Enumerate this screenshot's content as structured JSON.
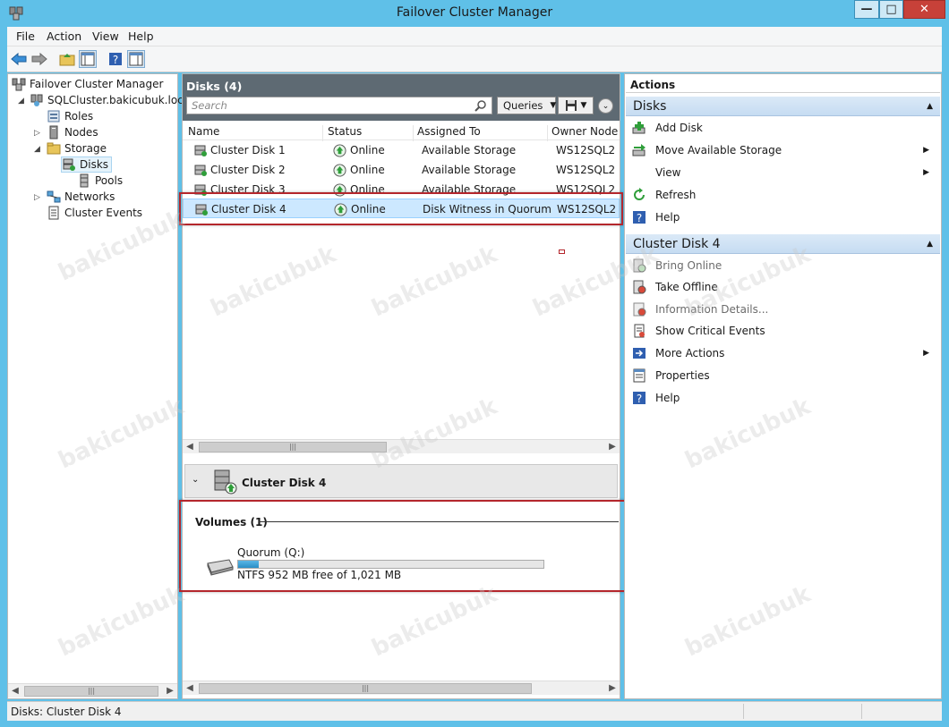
{
  "window": {
    "title": "Failover Cluster Manager",
    "btn_minimize": "—",
    "btn_maximize": "□",
    "btn_close": "✕"
  },
  "menu": [
    "File",
    "Action",
    "View",
    "Help"
  ],
  "tree": {
    "root": "Failover Cluster Manager",
    "cluster": "SQLCluster.bakicubuk.local",
    "roles": "Roles",
    "nodes": "Nodes",
    "storage": "Storage",
    "disks": "Disks",
    "pools": "Pools",
    "networks": "Networks",
    "events": "Cluster Events"
  },
  "center": {
    "title": "Disks (4)",
    "search_placeholder": "Search",
    "queries_label": "Queries",
    "columns": [
      "Name",
      "Status",
      "Assigned To",
      "Owner Node"
    ],
    "rows": [
      {
        "name": "Cluster Disk 1",
        "status": "Online",
        "assigned": "Available Storage",
        "owner": "WS12SQL2"
      },
      {
        "name": "Cluster Disk 2",
        "status": "Online",
        "assigned": "Available Storage",
        "owner": "WS12SQL2"
      },
      {
        "name": "Cluster Disk 3",
        "status": "Online",
        "assigned": "Available Storage",
        "owner": "WS12SQL2"
      },
      {
        "name": "Cluster Disk 4",
        "status": "Online",
        "assigned": "Disk Witness in Quorum",
        "owner": "WS12SQL2"
      }
    ],
    "detail": {
      "title": "Cluster Disk 4",
      "volumes_label": "Volumes (1)",
      "volume_name": "Quorum (Q:)",
      "volume_info": "NTFS 952 MB free of 1,021 MB",
      "used_fraction": 0.068
    }
  },
  "actions": {
    "header": "Actions",
    "section1": "Disks",
    "section1_items": [
      {
        "label": "Add Disk",
        "icon": "add-disk-icon"
      },
      {
        "label": "Move Available Storage",
        "icon": "move-storage-icon",
        "submenu": true
      },
      {
        "label": "View",
        "icon": "",
        "submenu": true
      },
      {
        "label": "Refresh",
        "icon": "refresh-icon"
      },
      {
        "label": "Help",
        "icon": "help-icon"
      }
    ],
    "section2": "Cluster Disk 4",
    "section2_items": [
      {
        "label": "Bring Online",
        "icon": "bring-online-icon",
        "disabled": true
      },
      {
        "label": "Take Offline",
        "icon": "take-offline-icon"
      },
      {
        "label": "Information Details...",
        "icon": "info-details-icon",
        "disabled": true
      },
      {
        "label": "Show Critical Events",
        "icon": "critical-events-icon"
      },
      {
        "label": "More Actions",
        "icon": "more-actions-icon",
        "submenu": true
      },
      {
        "label": "Properties",
        "icon": "properties-icon"
      },
      {
        "label": "Help",
        "icon": "help-icon"
      }
    ]
  },
  "status": {
    "text": "Disks:  Cluster Disk 4"
  },
  "watermark": "bakicubuk",
  "colors": {
    "titlebar": "#5fc0e8",
    "header_dark": "#5e6a73",
    "selected_row": "#cce8ff",
    "highlight_box": "#b4262c",
    "online_green": "#2f9e3a",
    "section_blue": "#c6dcf2",
    "progress_fill": "#2a8fc6"
  }
}
